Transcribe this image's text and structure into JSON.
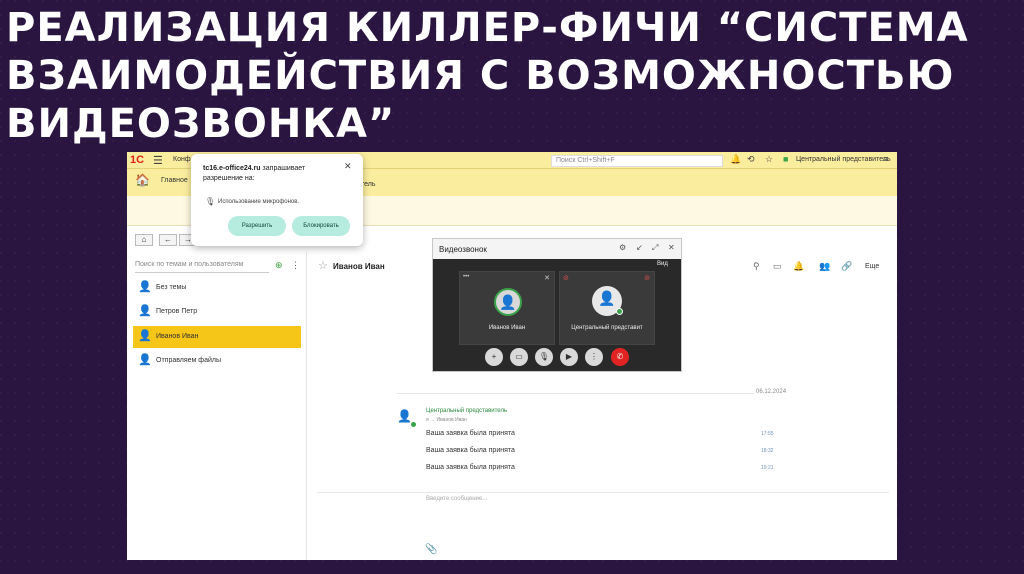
{
  "slide": {
    "title": "РЕАЛИЗАЦИЯ КИЛЛЕР-ФИЧИ “СИСТЕМА ВЗАИМОДЕЙСТВИЯ С ВОЗМОЖНОСТЬЮ ВИДЕОЗВОНКА”"
  },
  "app": {
    "logo": "1С",
    "config_label": "Конф",
    "search_placeholder": "Поиск Ctrl+Shift+F",
    "user": "Центральный представитель",
    "home_label": "Главное",
    "section_label": "тель"
  },
  "permission": {
    "site": "tc16.e-office24.ru",
    "request": "запрашивает разрешение на:",
    "item": "Использование микрофонов.",
    "allow": "Разрешить",
    "block": "Блокировать"
  },
  "sidebar": {
    "search_placeholder": "Поиск по темам и пользователям",
    "items": [
      {
        "label": "Без темы",
        "active": false
      },
      {
        "label": "Петров Петр",
        "active": false
      },
      {
        "label": "Иванов Иван",
        "active": true
      },
      {
        "label": "Отправляем файлы",
        "active": false
      }
    ]
  },
  "chat": {
    "title": "Иванов Иван",
    "more": "Еще",
    "date": "06.12.2024",
    "author": "Центральный представитель",
    "route": "я → Иванов Иван",
    "messages": [
      {
        "text": "Ваша заявка была принята",
        "time": "17:55"
      },
      {
        "text": "Ваша заявка была принята",
        "time": "18:32"
      },
      {
        "text": "Ваша заявка была принята",
        "time": "19:21"
      }
    ],
    "compose_placeholder": "Введите сообщение..."
  },
  "videocall": {
    "title": "Видеозвонок",
    "view": "Вид",
    "participants": [
      {
        "name": "Иванов Иван"
      },
      {
        "name": "Центральный представит"
      }
    ]
  },
  "colors": {
    "background": "#2a1540",
    "app_bar": "#fbed9e",
    "active_item": "#f5c518",
    "accent_green": "#3aa34a",
    "end_call": "#e02424"
  }
}
